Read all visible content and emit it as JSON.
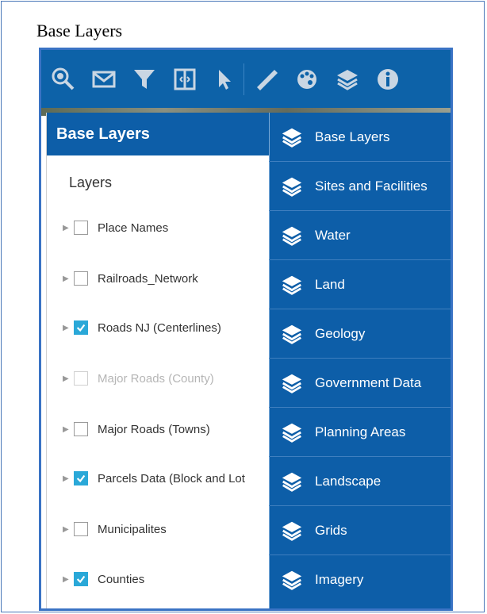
{
  "document": {
    "caption": "Base Layers"
  },
  "toolbar": {
    "tools": [
      {
        "icon": "map-search-icon"
      },
      {
        "icon": "envelope-icon"
      },
      {
        "icon": "filter-icon"
      },
      {
        "icon": "swipe-compare-icon"
      },
      {
        "icon": "select-cursor-icon"
      },
      {
        "icon": "measure-ruler-icon"
      },
      {
        "icon": "palette-icon"
      },
      {
        "icon": "layers-icon"
      },
      {
        "icon": "info-icon"
      }
    ],
    "colors": {
      "background": "#0d62a8",
      "icon": "#c9d6e3"
    }
  },
  "panel": {
    "header": "Base Layers",
    "subtitle": "Layers",
    "layers": [
      {
        "label": "Place Names",
        "checked": false,
        "disabled": false
      },
      {
        "label": "Railroads_Network",
        "checked": false,
        "disabled": false
      },
      {
        "label": "Roads NJ (Centerlines)",
        "checked": true,
        "disabled": false
      },
      {
        "label": "Major Roads (County)",
        "checked": false,
        "disabled": true
      },
      {
        "label": "Major Roads (Towns)",
        "checked": false,
        "disabled": false
      },
      {
        "label": "Parcels Data (Block and Lot",
        "checked": true,
        "disabled": false
      },
      {
        "label": "Municipalites",
        "checked": false,
        "disabled": false
      },
      {
        "label": "Counties",
        "checked": true,
        "disabled": false
      }
    ]
  },
  "menu": {
    "items": [
      {
        "label": "Base Layers"
      },
      {
        "label": "Sites and Facilities"
      },
      {
        "label": "Water"
      },
      {
        "label": "Land"
      },
      {
        "label": "Geology"
      },
      {
        "label": "Government Data"
      },
      {
        "label": "Planning Areas"
      },
      {
        "label": "Landscape"
      },
      {
        "label": "Grids"
      },
      {
        "label": "Imagery"
      }
    ],
    "colors": {
      "background": "#0d5ea8",
      "text": "#ffffff"
    }
  }
}
